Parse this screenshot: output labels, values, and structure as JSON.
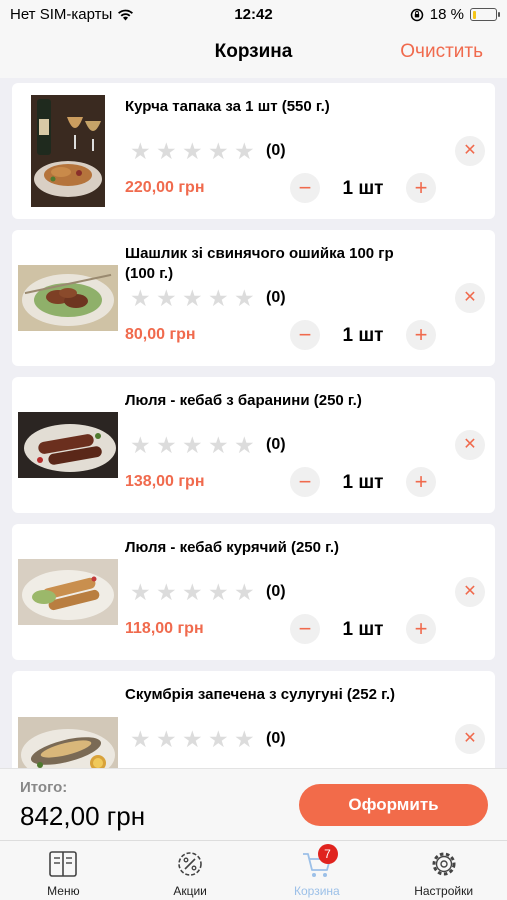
{
  "status_bar": {
    "carrier": "Нет SIM-карты",
    "time": "12:42",
    "battery": "18 %",
    "battery_level": 0.18
  },
  "nav": {
    "title": "Корзина",
    "clear_label": "Очистить"
  },
  "cart_items": [
    {
      "name": "Курча тапака за 1 шт (550 г.)",
      "rating_count": "(0)",
      "price": "220,00 грн",
      "qty": "1 шт"
    },
    {
      "name": "Шашлик зі свинячого ошийка 100 гр (100 г.)",
      "rating_count": "(0)",
      "price": "80,00 грн",
      "qty": "1 шт"
    },
    {
      "name": "Люля - кебаб з баранини (250 г.)",
      "rating_count": "(0)",
      "price": "138,00 грн",
      "qty": "1 шт"
    },
    {
      "name": "Люля - кебаб курячий (250 г.)",
      "rating_count": "(0)",
      "price": "118,00 грн",
      "qty": "1 шт"
    },
    {
      "name": "Скумбрія запечена з сулугуні (252 г.)",
      "rating_count": "(0)",
      "price": "",
      "qty": ""
    }
  ],
  "buttons": {
    "minus": "−",
    "plus": "+",
    "remove": "✕",
    "star": "★"
  },
  "footer": {
    "total_label": "Итого:",
    "total_value": "842,00 грн",
    "checkout_label": "Оформить"
  },
  "tabs": [
    {
      "label": "Меню",
      "icon": "menu-book-icon"
    },
    {
      "label": "Акции",
      "icon": "discount-gear-icon"
    },
    {
      "label": "Корзина",
      "icon": "cart-icon",
      "badge": "7",
      "active": true
    },
    {
      "label": "Настройки",
      "icon": "settings-gear-icon"
    }
  ],
  "colors": {
    "accent": "#f06a4d",
    "checkout": "#f26b4a",
    "badge": "#e0231e",
    "active_tab": "#9cc0e8",
    "star_empty": "#dcdcdc"
  }
}
